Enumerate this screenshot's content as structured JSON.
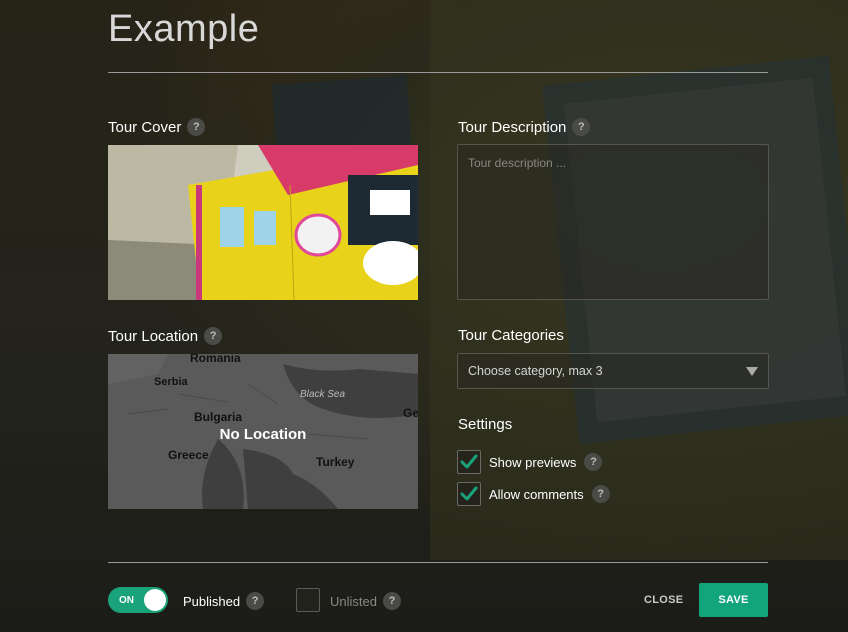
{
  "modal": {
    "title": "Example"
  },
  "cover": {
    "label": "Tour Cover",
    "help": "?"
  },
  "description": {
    "label": "Tour Description",
    "help": "?",
    "placeholder": "Tour description ..."
  },
  "location": {
    "label": "Tour Location",
    "help": "?",
    "status": "No Location",
    "map_labels": {
      "romania": "Romania",
      "serbia": "Serbia",
      "bulgaria": "Bulgaria",
      "greece": "Greece",
      "turkey": "Turkey",
      "black_sea": "Black Sea",
      "ge": "Ge"
    }
  },
  "categories": {
    "label": "Tour Categories",
    "placeholder": "Choose category, max 3"
  },
  "settings": {
    "label": "Settings",
    "items": [
      {
        "label": "Show previews",
        "checked": true,
        "help": "?"
      },
      {
        "label": "Allow comments",
        "checked": true,
        "help": "?"
      }
    ]
  },
  "footer": {
    "toggle_text": "ON",
    "published_label": "Published",
    "published_help": "?",
    "unlisted_label": "Unlisted",
    "unlisted_help": "?",
    "close_label": "CLOSE",
    "save_label": "SAVE"
  },
  "colors": {
    "accent": "#12a57b",
    "check": "#1aa37a"
  }
}
